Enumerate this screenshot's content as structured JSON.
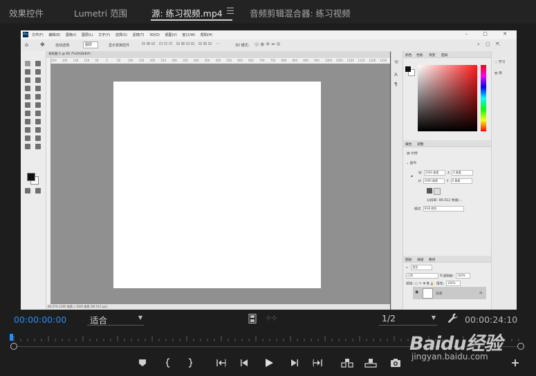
{
  "tabs": {
    "effects_controls": "效果控件",
    "lumetri_scopes": "Lumetri 范围",
    "source": "源: 练习视频.mp4",
    "audio_mixer": "音频剪辑混合器: 练习视频"
  },
  "monitor": {
    "current_timecode": "00:00:00:00",
    "duration_timecode": "00:00:24:10",
    "fit_label": "适合",
    "resolution_label": "1/2"
  },
  "photoshop": {
    "logo": "Ps",
    "menu": [
      "文件(F)",
      "编辑(E)",
      "图像(I)",
      "图层(L)",
      "文字(Y)",
      "选择(S)",
      "滤镜(T)",
      "3D(D)",
      "视图(V)",
      "窗口(W)",
      "帮助(H)"
    ],
    "options": {
      "auto_select": "自动选择:",
      "layer_label": "图层",
      "show_transform": "显示变换控件",
      "mode_3d": "3D 模式:"
    },
    "doc_tab": "未标题-1 @ 66.7%(RGB/8#)",
    "status_bar": "66.67%  1000 像素 x 1000 像素 (96.012 ppi)",
    "ruler_numbers": [
      "250",
      "200",
      "150",
      "100",
      "50",
      "0",
      "50",
      "100",
      "150",
      "200",
      "250",
      "300",
      "350",
      "400",
      "450",
      "500",
      "550",
      "600",
      "650",
      "700",
      "750",
      "800",
      "850",
      "900",
      "950",
      "1000",
      "1050",
      "1100",
      "1150",
      "1200",
      "1250"
    ],
    "color_panel_tabs": [
      "颜色",
      "色板",
      "渐变",
      "图案"
    ],
    "properties": {
      "tabs": [
        "属性",
        "调整"
      ],
      "doc_label": "文档",
      "canvas_heading": "画布",
      "w_label": "W",
      "w_value": "1000 像素",
      "h_label": "H",
      "h_value": "1000 像素",
      "x_label": "X",
      "x_value": "0 像素",
      "y_label": "Y",
      "y_value": "0 像素",
      "resolution": "分辨率: 96.012 像素/...",
      "mode_label": "模式",
      "mode_value": "RGB 颜色"
    },
    "layers": {
      "tabs": [
        "图层",
        "通道",
        "路径"
      ],
      "kind_filter": "类型",
      "blend_mode": "正常",
      "opacity_label": "不透明度:",
      "opacity_value": "100%",
      "lock_label": "锁定:",
      "fill_label": "填充:",
      "fill_value": "100%",
      "layer_name": "背景"
    },
    "right_strip": {
      "learn": "学习",
      "libraries": "库"
    }
  },
  "watermark": {
    "brand": "Baidu经验",
    "url": "jingyan.baidu.com"
  }
}
